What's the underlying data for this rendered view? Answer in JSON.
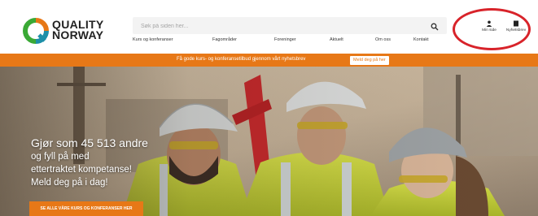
{
  "brand": {
    "line1": "QUALITY",
    "line2": "NORWAY"
  },
  "search": {
    "placeholder": "Søk på siden her..."
  },
  "nav": {
    "items": [
      "Kurs og konferanser",
      "Fagområder",
      "Foreninger",
      "Aktuelt",
      "Om oss",
      "Kontakt"
    ]
  },
  "utility": {
    "my_page": "Min side",
    "newsletter": "Nyhetsbrev"
  },
  "promo": {
    "text": "Få gode kurs- og konferansetilbud gjennom vårt nyhetsbrev",
    "button": "Meld deg på her"
  },
  "hero": {
    "line1": "Gjør som 45 513 andre",
    "line2": "og fyll på med",
    "line3": "ettertraktet kompetanse!",
    "line4": "Meld deg på i dag!",
    "cta": "SE ALLE VÅRE KURS OG KONFERANSER HER"
  },
  "colors": {
    "accent": "#e77817",
    "highlight_ring": "#d8232a",
    "logo_green": "#3aa935",
    "logo_teal": "#1d8fa8",
    "logo_orange": "#e77817"
  }
}
